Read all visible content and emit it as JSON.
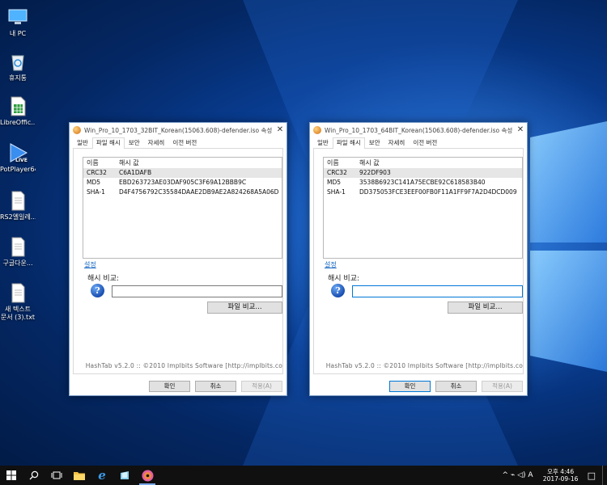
{
  "desktop": {
    "icons": [
      {
        "label": "내 PC",
        "icon": "this-pc-icon"
      },
      {
        "label": "휴지통",
        "icon": "recycle-bin-icon"
      },
      {
        "label": "LibreOffic...",
        "icon": "libreoffice-calc-icon"
      },
      {
        "label": "PotPlayer64",
        "icon": "potplayer-icon",
        "badge": "LIVE"
      },
      {
        "label": "RS2엘일레...",
        "icon": "document-icon"
      },
      {
        "label": "구글다운...",
        "icon": "document-icon"
      },
      {
        "label": "새 텍스트\n문서 (3).txt",
        "icon": "text-file-icon"
      }
    ]
  },
  "windows": [
    {
      "title": "Win_Pro_10_1703_32BIT_Korean(15063.608)-defender.iso 속성",
      "close": "✕",
      "tabs": [
        "일반",
        "파일 해시",
        "보안",
        "자세히",
        "이전 버전"
      ],
      "active_tab": "파일 해시",
      "columns": {
        "name": "이름",
        "value": "해시 값"
      },
      "rows": [
        {
          "name": "CRC32",
          "value": "C6A1DAFB"
        },
        {
          "name": "MD5",
          "value": "EBD263723AE03DAF905C3F69A12BBB9C"
        },
        {
          "name": "SHA-1",
          "value": "D4F4756792C35584DAAE2DB9AE2A824268A5A06D"
        }
      ],
      "settings_link": "설정",
      "compare_label": "해시 비교:",
      "compare_value": "",
      "file_compare_button": "파일 비교...",
      "about": "HashTab v5.2.0 :: ©2010 Implbits Software [http://implbits.co",
      "buttons": {
        "ok": "확인",
        "cancel": "취소",
        "apply": "적용(A)"
      }
    },
    {
      "title": "Win_Pro_10_1703_64BIT_Korean(15063.608)-defender.iso 속성",
      "close": "✕",
      "tabs": [
        "일반",
        "파일 해시",
        "보안",
        "자세히",
        "이전 버전"
      ],
      "active_tab": "파일 해시",
      "columns": {
        "name": "이름",
        "value": "해시 값"
      },
      "rows": [
        {
          "name": "CRC32",
          "value": "922DF903"
        },
        {
          "name": "MD5",
          "value": "3538B6923C141A75ECBE92C618583B40"
        },
        {
          "name": "SHA-1",
          "value": "DD375053FCE3EEF00FB0F11A1FF9F7A2D4DCD009"
        }
      ],
      "settings_link": "설정",
      "compare_label": "해시 비교:",
      "compare_value": "",
      "file_compare_button": "파일 비교...",
      "about": "HashTab v5.2.0 :: ©2010 Implbits Software [http://implbits.co",
      "buttons": {
        "ok": "확인",
        "cancel": "취소",
        "apply": "적용(A)"
      }
    }
  ],
  "taskbar": {
    "apps": [
      "start-icon",
      "search-icon",
      "task-view-icon",
      "file-explorer-icon",
      "edge-icon",
      "store-icon",
      "app-disc-icon"
    ],
    "tray_symbols": "^ ⌁ ◁) A",
    "time": "오후 4:46",
    "date": "2017-09-16",
    "notifications": "□"
  }
}
